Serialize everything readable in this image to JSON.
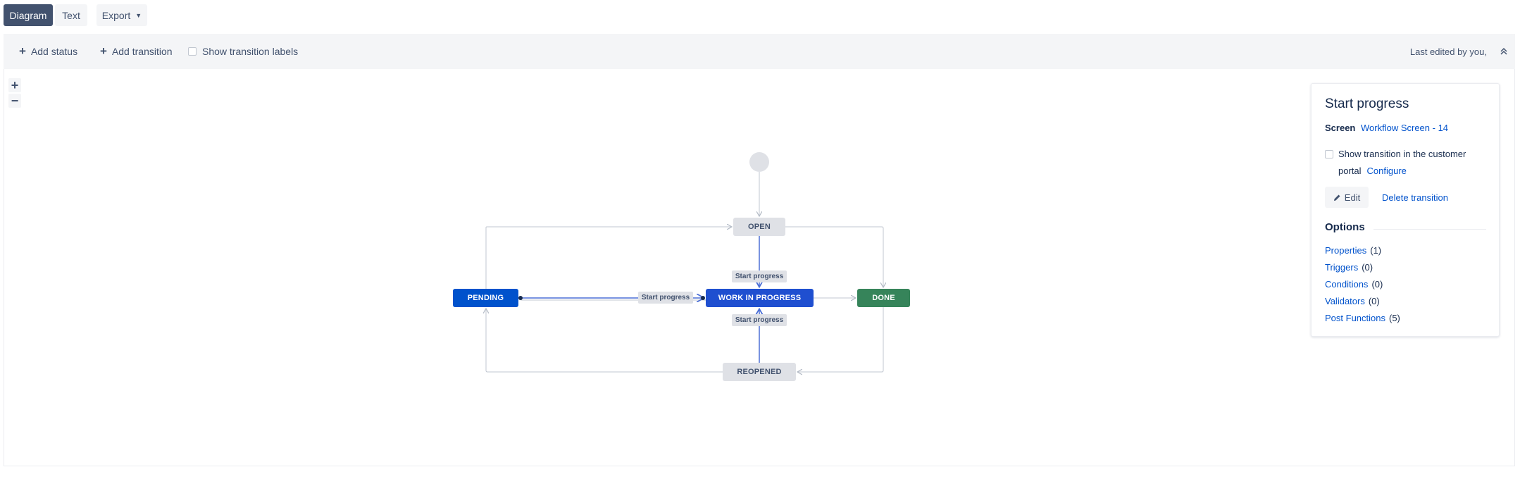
{
  "tabs": {
    "diagram": "Diagram",
    "text": "Text",
    "export": "Export"
  },
  "toolbar": {
    "add_status": "Add status",
    "add_transition": "Add transition",
    "show_labels": "Show transition labels",
    "last_edited": "Last edited by you,"
  },
  "zoom": {
    "in": "+",
    "out": "−"
  },
  "statuses": {
    "open": "OPEN",
    "pending": "PENDING",
    "wip": "WORK IN PROGRESS",
    "done": "DONE",
    "reopened": "REOPENED"
  },
  "transition_labels": {
    "top": "Start progress",
    "left": "Start progress",
    "bottom": "Start progress"
  },
  "panel": {
    "title": "Start progress",
    "screen_label": "Screen",
    "screen_value": "Workflow Screen - 14",
    "portal_text": "Show transition in the customer portal",
    "configure": "Configure",
    "edit": "Edit",
    "delete": "Delete transition",
    "options_title": "Options",
    "options": [
      {
        "label": "Properties",
        "count": "(1)"
      },
      {
        "label": "Triggers",
        "count": "(0)"
      },
      {
        "label": "Conditions",
        "count": "(0)"
      },
      {
        "label": "Validators",
        "count": "(0)"
      },
      {
        "label": "Post Functions",
        "count": "(5)"
      }
    ]
  },
  "colors": {
    "blue_status": "#0052cc",
    "done_green": "#36845a",
    "neutral_status": "#dfe1e6",
    "link": "#0052cc"
  },
  "icons": {
    "plus": "plus-icon",
    "caret": "chevron-down-icon",
    "collapse": "double-chevron-up-icon",
    "pencil": "pencil-icon"
  }
}
